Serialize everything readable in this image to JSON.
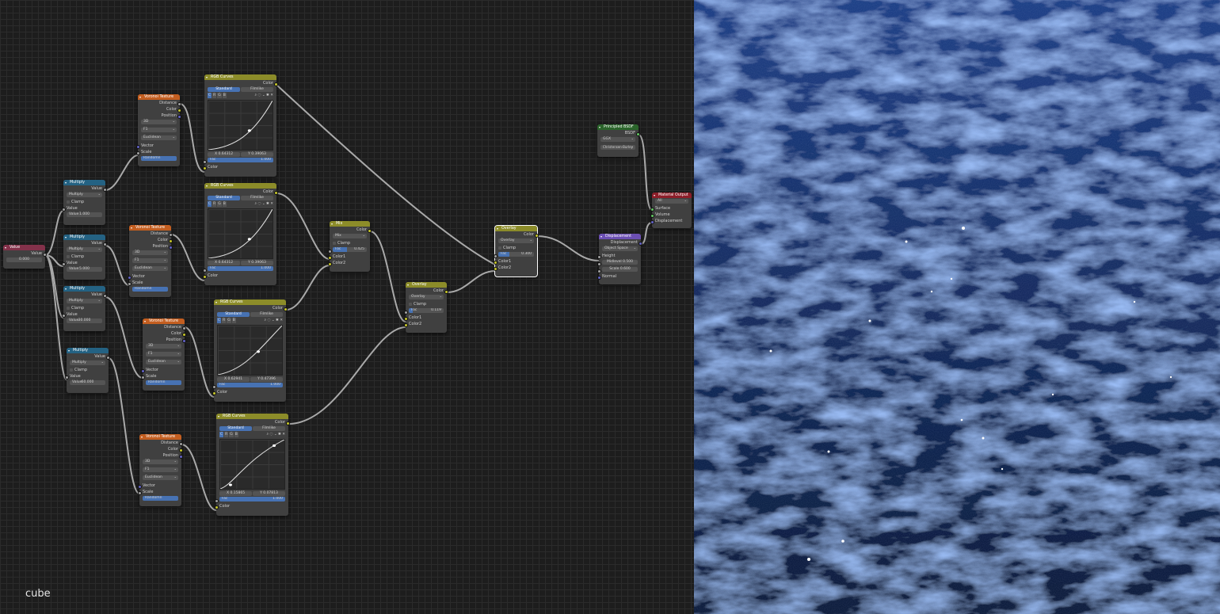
{
  "overlay": {
    "object_name": "cube"
  },
  "value_node": {
    "title": "Value",
    "output": "Value",
    "value": "0.000"
  },
  "math_nodes": [
    {
      "title": "Multiply",
      "output": "Value",
      "operation": "Multiply",
      "clamp": "Clamp",
      "input_label": "Value",
      "field_label": "Value",
      "field_value": "1.000"
    },
    {
      "title": "Multiply",
      "output": "Value",
      "operation": "Multiply",
      "clamp": "Clamp",
      "input_label": "Value",
      "field_label": "Value",
      "field_value": "5.000"
    },
    {
      "title": "Multiply",
      "output": "Value",
      "operation": "Multiply",
      "clamp": "Clamp",
      "input_label": "Value",
      "field_label": "Value",
      "field_value": "30.000"
    },
    {
      "title": "Multiply",
      "output": "Value",
      "operation": "Multiply",
      "clamp": "Clamp",
      "input_label": "Value",
      "field_label": "Value",
      "field_value": "60.000"
    }
  ],
  "voronoi_nodes": [
    {
      "title": "Voronoi Texture",
      "outputs": [
        "Distance",
        "Color",
        "Position"
      ],
      "dimensions": "3D",
      "feature": "F1",
      "metric": "Euclidean",
      "inputs": [
        "Vector",
        "Scale"
      ],
      "rand_label": "Randomn",
      "rand_value": "1.000"
    },
    {
      "title": "Voronoi Texture",
      "outputs": [
        "Distance",
        "Color",
        "Position"
      ],
      "dimensions": "3D",
      "feature": "F1",
      "metric": "Euclidean",
      "inputs": [
        "Vector",
        "Scale"
      ],
      "rand_label": "Randomn",
      "rand_value": "1.000"
    },
    {
      "title": "Voronoi Texture",
      "outputs": [
        "Distance",
        "Color",
        "Position"
      ],
      "dimensions": "3D",
      "feature": "F1",
      "metric": "Euclidean",
      "inputs": [
        "Vector",
        "Scale"
      ],
      "rand_label": "Randomn",
      "rand_value": "1.000"
    },
    {
      "title": "Voronoi Texture",
      "outputs": [
        "Distance",
        "Color",
        "Position"
      ],
      "dimensions": "3D",
      "feature": "F1",
      "metric": "Euclidean",
      "inputs": [
        "Vector",
        "Scale"
      ],
      "rand_label": "Randomn",
      "rand_value": "1.000"
    }
  ],
  "curves_nodes": [
    {
      "title": "RGB Curves",
      "output": "Color",
      "tab_standard": "Standard",
      "tab_filmlike": "Filmlike",
      "channels": [
        "C",
        "R",
        "G",
        "B"
      ],
      "x": "X 0.64312",
      "y": "Y 0.39063",
      "fac_label": "Fac",
      "fac_value": "1.000",
      "input": "Color"
    },
    {
      "title": "RGB Curves",
      "output": "Color",
      "tab_standard": "Standard",
      "tab_filmlike": "Filmlike",
      "channels": [
        "C",
        "R",
        "G",
        "B"
      ],
      "x": "X 0.64312",
      "y": "Y 0.39063",
      "fac_label": "Fac",
      "fac_value": "1.000",
      "input": "Color"
    },
    {
      "title": "RGB Curves",
      "output": "Color",
      "tab_standard": "Standard",
      "tab_filmlike": "Filmlike",
      "channels": [
        "C",
        "R",
        "G",
        "B"
      ],
      "x": "X 0.62941",
      "y": "Y 0.47396",
      "fac_label": "Fac",
      "fac_value": "1.000",
      "input": "Color"
    },
    {
      "title": "RGB Curves",
      "output": "Color",
      "tab_standard": "Standard",
      "tab_filmlike": "Filmlike",
      "channels": [
        "C",
        "R",
        "G",
        "B"
      ],
      "x": "X 0.15865",
      "y": "Y 0.07813",
      "fac_label": "Fac",
      "fac_value": "1.000",
      "input": "Color"
    }
  ],
  "mix_nodes": [
    {
      "title": "Mix",
      "output": "Color",
      "blend": "Mix",
      "clamp": "Clamp",
      "fac_label": "Fac",
      "fac_value": "0.425",
      "in1": "Color1",
      "in2": "Color2"
    },
    {
      "title": "Overlay",
      "output": "Color",
      "blend": "Overlay",
      "clamp": "Clamp",
      "fac_label": "Fac",
      "fac_value": "0.119",
      "in1": "Color1",
      "in2": "Color2"
    },
    {
      "title": "Overlay",
      "output": "Color",
      "blend": "Overlay",
      "clamp": "Clamp",
      "fac_label": "Fac",
      "fac_value": "0.300",
      "in1": "Color1",
      "in2": "Color2"
    }
  ],
  "bsdf_node": {
    "title": "Principled BSDF",
    "output": "BSDF",
    "distribution": "GGX",
    "subsurface": "Christensen-Burley"
  },
  "displacement_node": {
    "title": "Displacement",
    "output": "Displacement",
    "space": "Object Space",
    "height": "Height",
    "midlevel_label": "Midlevel",
    "midlevel_value": "0.500",
    "scale_label": "Scale",
    "scale_value": "0.600",
    "normal": "Normal"
  },
  "output_node": {
    "title": "Material Output",
    "target": "All",
    "inputs": [
      "Surface",
      "Volume",
      "Displacement"
    ]
  },
  "colors": {
    "grid_bg": "#1d1d1d",
    "node_bg": "#404040",
    "accent": "#4772b3",
    "link": "#c8c8c8"
  }
}
